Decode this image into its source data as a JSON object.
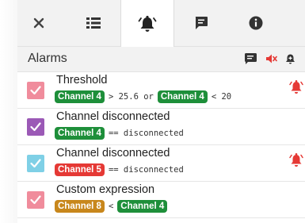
{
  "tabs": [
    {
      "icon": "close-icon",
      "active": false
    },
    {
      "icon": "list-icon",
      "active": false
    },
    {
      "icon": "alarm-bell-icon",
      "active": true
    },
    {
      "icon": "comment-icon",
      "active": false
    },
    {
      "icon": "info-icon",
      "active": false
    }
  ],
  "section": {
    "title": "Alarms",
    "actions": [
      "alarm-list-icon",
      "mute-icon",
      "add-alarm-icon"
    ]
  },
  "colors": {
    "checkbox_pink": "#f08c9c",
    "checkbox_purple": "#9b59b6",
    "checkbox_cyan": "#7fd0e6",
    "chip_green": "#1e8f3a",
    "chip_red": "#e53935",
    "chip_orange": "#c8871c",
    "bell_red": "#e53935"
  },
  "alarms": [
    {
      "title": "Threshold",
      "checkbox_color": "#f08c9c",
      "ringing": true,
      "expr": {
        "chip1": "Channel 4",
        "chip1_color": "#1e8f3a",
        "op1": "> 25.6 or",
        "chip2": "Channel 4",
        "chip2_color": "#1e8f3a",
        "op2": "< 20"
      }
    },
    {
      "title": "Channel disconnected",
      "checkbox_color": "#9b59b6",
      "ringing": false,
      "expr": {
        "chip1": "Channel 4",
        "chip1_color": "#1e8f3a",
        "op1": "== disconnected"
      }
    },
    {
      "title": "Channel disconnected",
      "checkbox_color": "#7fd0e6",
      "ringing": true,
      "expr": {
        "chip1": "Channel 5",
        "chip1_color": "#e53935",
        "op1": "== disconnected"
      }
    },
    {
      "title": "Custom expression",
      "checkbox_color": "#f08c9c",
      "ringing": false,
      "expr": {
        "chip1": "Channel 8",
        "chip1_color": "#c8871c",
        "op1": "<",
        "chip2": "Channel 4",
        "chip2_color": "#1e8f3a"
      }
    }
  ]
}
